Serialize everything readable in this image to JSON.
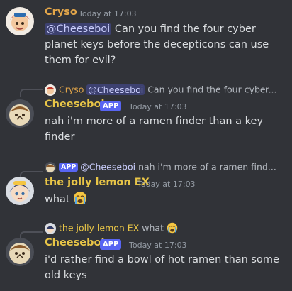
{
  "colors": {
    "cryso": "#e3a64a",
    "cheeseboi": "#e8c547",
    "lemon": "#e8c547",
    "app_badge": "#5865f2"
  },
  "messages": [
    {
      "author": "Cryso",
      "timestamp": "Today at 17:03",
      "mention": "@Cheeseboi",
      "text": "Can you find the four cyber planet keys before the decepticons can use them for evil?"
    },
    {
      "reply_author": "Cryso",
      "reply_mention": "@Cheeseboi",
      "reply_text": "Can you find the four cyber...",
      "author": "Cheeseboi",
      "badge": "APP",
      "timestamp": "Today at 17:03",
      "text": "nah i'm more of a ramen finder than a key finder"
    },
    {
      "reply_badge": "APP",
      "reply_author": "@Cheeseboi",
      "reply_text": "nah i'm more of a ramen find...",
      "author": "the jolly lemon EX",
      "timestamp": "Today at 17:03",
      "text": "what",
      "emoji": "crying-face-emoji"
    },
    {
      "reply_author": "the jolly lemon EX",
      "reply_text": "what",
      "reply_emoji": "crying-face-emoji",
      "author": "Cheeseboi",
      "badge": "APP",
      "timestamp": "Today at 17:03",
      "text": "i'd rather find a bowl of hot ramen than some old keys"
    }
  ]
}
